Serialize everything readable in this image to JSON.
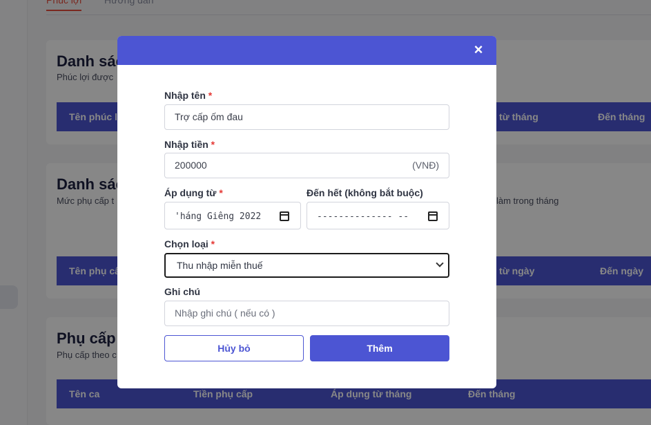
{
  "background": {
    "tabs": [
      "Phúc lợi",
      "Hướng dẫn"
    ],
    "cards": [
      {
        "title": "Danh sác",
        "subtitle": "Phúc lợi được",
        "columns": [
          "Tên phúc lợ",
          "ng từ tháng",
          "Đến tháng"
        ]
      },
      {
        "title": "Danh sác",
        "subtitle": "Mức phụ cấp t",
        "subtitle_right": "làm trong tháng",
        "columns": [
          "Tên phụ cấp",
          "ng từ ngày",
          "Đến ngày"
        ]
      },
      {
        "title": "Phụ cấp t",
        "subtitle": "Phụ cấp theo c",
        "columns": [
          "Tên ca",
          "Tiền phụ cấp",
          "Áp dụng từ tháng",
          "Đến tháng"
        ]
      }
    ]
  },
  "modal": {
    "close_icon": "×",
    "name": {
      "label": "Nhập tên",
      "value": "Trợ cấp ốm đau"
    },
    "amount": {
      "label": "Nhập tiền",
      "value": "200000",
      "unit": "(VNĐ)"
    },
    "start": {
      "label": "Áp dụng từ",
      "value": "'háng Giêng 2022"
    },
    "end": {
      "label": "Đến hết (không bắt buộc)",
      "value": "-------------- --"
    },
    "type": {
      "label": "Chọn loại",
      "value": "Thu nhập miễn thuế"
    },
    "note": {
      "label": "Ghi chú",
      "placeholder": "Nhập ghi chú ( nếu có )"
    },
    "required_mark": "*",
    "cancel_label": "Hủy bỏ",
    "submit_label": "Thêm"
  }
}
